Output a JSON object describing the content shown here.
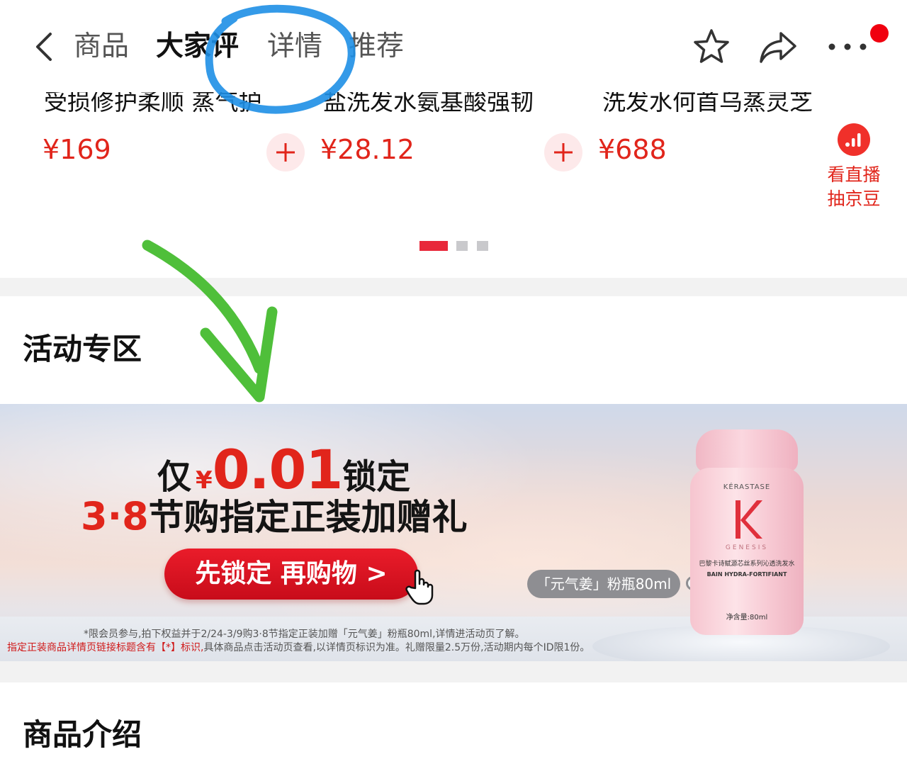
{
  "nav": {
    "back_icon": "chevron-left-icon",
    "tabs": [
      "商品",
      "大家评",
      "详情",
      "推荐"
    ],
    "active_tab": "大家评",
    "favorite_icon": "star-icon",
    "share_icon": "share-icon",
    "more_icon": "more-icon",
    "notification_dot_color": "#f0000f"
  },
  "recommendations": {
    "items": [
      {
        "title": "受损修护柔顺 蒸气护",
        "price": "¥169"
      },
      {
        "title": "盐洗发水氨基酸强韧",
        "price": "¥28.12"
      },
      {
        "title": "洗发水何首乌蒸灵芝",
        "price": "¥688"
      }
    ],
    "add_icon": "plus-icon",
    "live": {
      "icon": "live-bars-icon",
      "label_line1": "看直播",
      "label_line2": "抽京豆"
    },
    "pager": {
      "count": 3,
      "active": 0
    }
  },
  "activity": {
    "section_title": "活动专区",
    "banner": {
      "line1_prefix": "仅",
      "line1_currency": "¥",
      "line1_price": "0.01",
      "line1_suffix": "锁定",
      "line2_number": "3·8",
      "line2_text": "节购指定正装加赠礼",
      "cta_label": "先锁定 再购物 >",
      "cursor_icon": "hand-pointer-icon",
      "volume_pill": "「元气姜」粉瓶80ml",
      "bottle": {
        "brand": "KÉRASTASE",
        "logo_letter": "K",
        "series": "GENESIS",
        "cn_name": "巴黎卡诗赋源芯丝系列沁透洗发水",
        "en_name": "BAIN HYDRA-FORTIFIANT",
        "volume": "净含量:80ml"
      },
      "fine_print_line1": "*限会员参与,拍下权益并于2/24-3/9购3·8节指定正装加赠「元气姜」粉瓶80ml,详情进活动页了解。",
      "fine_print_line2_red": "指定正装商品详情页链接标题含有【*】标识,",
      "fine_print_line2": "具体商品点击活动页查看,以详情页标识为准。礼赠限量2.5万份,活动期内每个ID限1份。"
    }
  },
  "product_intro": {
    "section_title": "商品介绍"
  },
  "colors": {
    "accent_red": "#e1251b",
    "annotation_circle": "#1e8fe6",
    "annotation_arrow": "#4fbf3a"
  }
}
